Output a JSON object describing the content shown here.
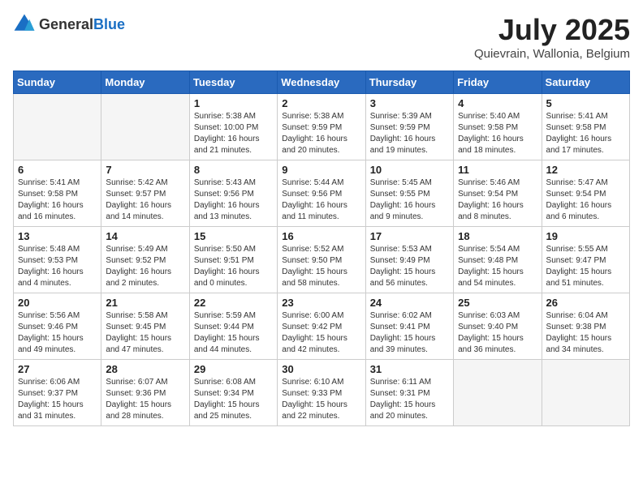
{
  "header": {
    "logo_general": "General",
    "logo_blue": "Blue",
    "month_title": "July 2025",
    "location": "Quievrain, Wallonia, Belgium"
  },
  "days_of_week": [
    "Sunday",
    "Monday",
    "Tuesday",
    "Wednesday",
    "Thursday",
    "Friday",
    "Saturday"
  ],
  "weeks": [
    [
      {
        "day": "",
        "empty": true
      },
      {
        "day": "",
        "empty": true
      },
      {
        "day": "1",
        "sunrise": "Sunrise: 5:38 AM",
        "sunset": "Sunset: 10:00 PM",
        "daylight": "Daylight: 16 hours and 21 minutes."
      },
      {
        "day": "2",
        "sunrise": "Sunrise: 5:38 AM",
        "sunset": "Sunset: 9:59 PM",
        "daylight": "Daylight: 16 hours and 20 minutes."
      },
      {
        "day": "3",
        "sunrise": "Sunrise: 5:39 AM",
        "sunset": "Sunset: 9:59 PM",
        "daylight": "Daylight: 16 hours and 19 minutes."
      },
      {
        "day": "4",
        "sunrise": "Sunrise: 5:40 AM",
        "sunset": "Sunset: 9:58 PM",
        "daylight": "Daylight: 16 hours and 18 minutes."
      },
      {
        "day": "5",
        "sunrise": "Sunrise: 5:41 AM",
        "sunset": "Sunset: 9:58 PM",
        "daylight": "Daylight: 16 hours and 17 minutes."
      }
    ],
    [
      {
        "day": "6",
        "sunrise": "Sunrise: 5:41 AM",
        "sunset": "Sunset: 9:58 PM",
        "daylight": "Daylight: 16 hours and 16 minutes."
      },
      {
        "day": "7",
        "sunrise": "Sunrise: 5:42 AM",
        "sunset": "Sunset: 9:57 PM",
        "daylight": "Daylight: 16 hours and 14 minutes."
      },
      {
        "day": "8",
        "sunrise": "Sunrise: 5:43 AM",
        "sunset": "Sunset: 9:56 PM",
        "daylight": "Daylight: 16 hours and 13 minutes."
      },
      {
        "day": "9",
        "sunrise": "Sunrise: 5:44 AM",
        "sunset": "Sunset: 9:56 PM",
        "daylight": "Daylight: 16 hours and 11 minutes."
      },
      {
        "day": "10",
        "sunrise": "Sunrise: 5:45 AM",
        "sunset": "Sunset: 9:55 PM",
        "daylight": "Daylight: 16 hours and 9 minutes."
      },
      {
        "day": "11",
        "sunrise": "Sunrise: 5:46 AM",
        "sunset": "Sunset: 9:54 PM",
        "daylight": "Daylight: 16 hours and 8 minutes."
      },
      {
        "day": "12",
        "sunrise": "Sunrise: 5:47 AM",
        "sunset": "Sunset: 9:54 PM",
        "daylight": "Daylight: 16 hours and 6 minutes."
      }
    ],
    [
      {
        "day": "13",
        "sunrise": "Sunrise: 5:48 AM",
        "sunset": "Sunset: 9:53 PM",
        "daylight": "Daylight: 16 hours and 4 minutes."
      },
      {
        "day": "14",
        "sunrise": "Sunrise: 5:49 AM",
        "sunset": "Sunset: 9:52 PM",
        "daylight": "Daylight: 16 hours and 2 minutes."
      },
      {
        "day": "15",
        "sunrise": "Sunrise: 5:50 AM",
        "sunset": "Sunset: 9:51 PM",
        "daylight": "Daylight: 16 hours and 0 minutes."
      },
      {
        "day": "16",
        "sunrise": "Sunrise: 5:52 AM",
        "sunset": "Sunset: 9:50 PM",
        "daylight": "Daylight: 15 hours and 58 minutes."
      },
      {
        "day": "17",
        "sunrise": "Sunrise: 5:53 AM",
        "sunset": "Sunset: 9:49 PM",
        "daylight": "Daylight: 15 hours and 56 minutes."
      },
      {
        "day": "18",
        "sunrise": "Sunrise: 5:54 AM",
        "sunset": "Sunset: 9:48 PM",
        "daylight": "Daylight: 15 hours and 54 minutes."
      },
      {
        "day": "19",
        "sunrise": "Sunrise: 5:55 AM",
        "sunset": "Sunset: 9:47 PM",
        "daylight": "Daylight: 15 hours and 51 minutes."
      }
    ],
    [
      {
        "day": "20",
        "sunrise": "Sunrise: 5:56 AM",
        "sunset": "Sunset: 9:46 PM",
        "daylight": "Daylight: 15 hours and 49 minutes."
      },
      {
        "day": "21",
        "sunrise": "Sunrise: 5:58 AM",
        "sunset": "Sunset: 9:45 PM",
        "daylight": "Daylight: 15 hours and 47 minutes."
      },
      {
        "day": "22",
        "sunrise": "Sunrise: 5:59 AM",
        "sunset": "Sunset: 9:44 PM",
        "daylight": "Daylight: 15 hours and 44 minutes."
      },
      {
        "day": "23",
        "sunrise": "Sunrise: 6:00 AM",
        "sunset": "Sunset: 9:42 PM",
        "daylight": "Daylight: 15 hours and 42 minutes."
      },
      {
        "day": "24",
        "sunrise": "Sunrise: 6:02 AM",
        "sunset": "Sunset: 9:41 PM",
        "daylight": "Daylight: 15 hours and 39 minutes."
      },
      {
        "day": "25",
        "sunrise": "Sunrise: 6:03 AM",
        "sunset": "Sunset: 9:40 PM",
        "daylight": "Daylight: 15 hours and 36 minutes."
      },
      {
        "day": "26",
        "sunrise": "Sunrise: 6:04 AM",
        "sunset": "Sunset: 9:38 PM",
        "daylight": "Daylight: 15 hours and 34 minutes."
      }
    ],
    [
      {
        "day": "27",
        "sunrise": "Sunrise: 6:06 AM",
        "sunset": "Sunset: 9:37 PM",
        "daylight": "Daylight: 15 hours and 31 minutes."
      },
      {
        "day": "28",
        "sunrise": "Sunrise: 6:07 AM",
        "sunset": "Sunset: 9:36 PM",
        "daylight": "Daylight: 15 hours and 28 minutes."
      },
      {
        "day": "29",
        "sunrise": "Sunrise: 6:08 AM",
        "sunset": "Sunset: 9:34 PM",
        "daylight": "Daylight: 15 hours and 25 minutes."
      },
      {
        "day": "30",
        "sunrise": "Sunrise: 6:10 AM",
        "sunset": "Sunset: 9:33 PM",
        "daylight": "Daylight: 15 hours and 22 minutes."
      },
      {
        "day": "31",
        "sunrise": "Sunrise: 6:11 AM",
        "sunset": "Sunset: 9:31 PM",
        "daylight": "Daylight: 15 hours and 20 minutes."
      },
      {
        "day": "",
        "empty": true
      },
      {
        "day": "",
        "empty": true
      }
    ]
  ]
}
